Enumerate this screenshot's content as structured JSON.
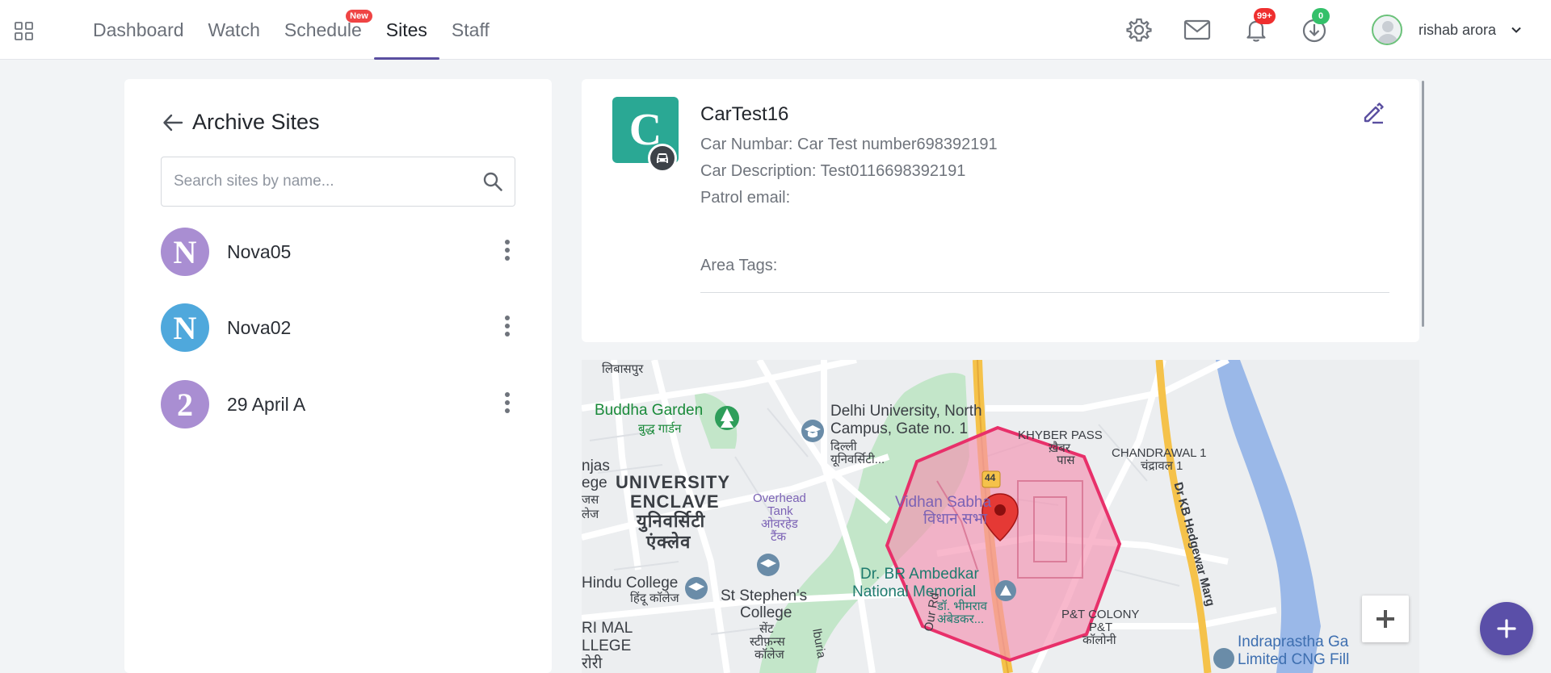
{
  "nav": {
    "items": [
      {
        "label": "Dashboard",
        "active": false
      },
      {
        "label": "Watch",
        "active": false
      },
      {
        "label": "Schedule",
        "active": false,
        "badge": "New"
      },
      {
        "label": "Sites",
        "active": true
      },
      {
        "label": "Staff",
        "active": false
      }
    ]
  },
  "header": {
    "notifications_badge": "99+",
    "downloads_badge": "0",
    "user_name": "rishab arora"
  },
  "sidebar": {
    "title": "Archive Sites",
    "search_placeholder": "Search sites by name...",
    "sites": [
      {
        "initial": "N",
        "name": "Nova05",
        "color": "#a98ed2"
      },
      {
        "initial": "N",
        "name": "Nova02",
        "color": "#4fa8dc"
      },
      {
        "initial": "2",
        "name": "29 April A",
        "color": "#a98ed2"
      }
    ]
  },
  "detail": {
    "initial": "C",
    "avatar_color": "#2aa894",
    "title": "CarTest16",
    "car_number": "Car Numbar: Car Test number698392191",
    "car_description": "Car Description: Test0116698392191",
    "patrol_email": "Patrol email:",
    "area_tags": "Area Tags:"
  },
  "map": {
    "labels": {
      "libaspur": "लिबासपुर",
      "buddha_garden": "Buddha Garden",
      "buddha_garden_hi": "बुद्ध गार्डन",
      "du_north": "Delhi University, North",
      "du_north2": "Campus, Gate no. 1",
      "du_hi": "दिल्ली",
      "du_hi2": "यूनिवर्सिटी...",
      "khyber": "KHYBER PASS",
      "khyber_hi": "ख़ैबर",
      "khyber_hi2": "पास",
      "chandrawal": "CHANDRAWAL 1",
      "chandrawal_hi": "चंद्रावल 1",
      "univ1": "UNIVERSITY",
      "univ2": "ENCLAVE",
      "univ_hi1": "युनिवर्सिटी",
      "univ_hi2": "एंक्लेव",
      "overhead": "Overhead",
      "tank": "Tank",
      "overhead_hi": "ओवरहेड",
      "tank_hi": "टैंक",
      "vidhan": "Vidhan Sabha",
      "vidhan_hi": "विधान सभा",
      "highway": "44",
      "ambedkar1": "Dr. BR Ambedkar",
      "ambedkar2": "National Memorial",
      "ambedkar_hi1": "डॉ. भीमराव",
      "ambedkar_hi2": "अंबेडकर...",
      "hindu": "Hindu College",
      "hindu_hi": "हिंदू कॉलेज",
      "stephens1": "St Stephen's",
      "stephens2": "College",
      "stephens_hi1": "सेंट",
      "stephens_hi2": "स्टीफ़न्स",
      "stephens_hi3": "कॉलेज",
      "ptcolony": "P&T COLONY",
      "pt_hi1": "P&T",
      "pt_hi2": "कॉलोनी",
      "hedgewar": "Dr KB Hedgewar Marg",
      "indraprastha1": "Indraprastha Ga",
      "indraprastha2": "Limited CNG Fill",
      "njas": "njas",
      "ege": "ege",
      "jas_hi": "जस",
      "jej_hi": "लेज",
      "rimal": "RI MAL",
      "llege": "LLEGE",
      "rori": "रोरी",
      "our_rd": "Our Rd",
      "lburia": "lburia"
    }
  }
}
